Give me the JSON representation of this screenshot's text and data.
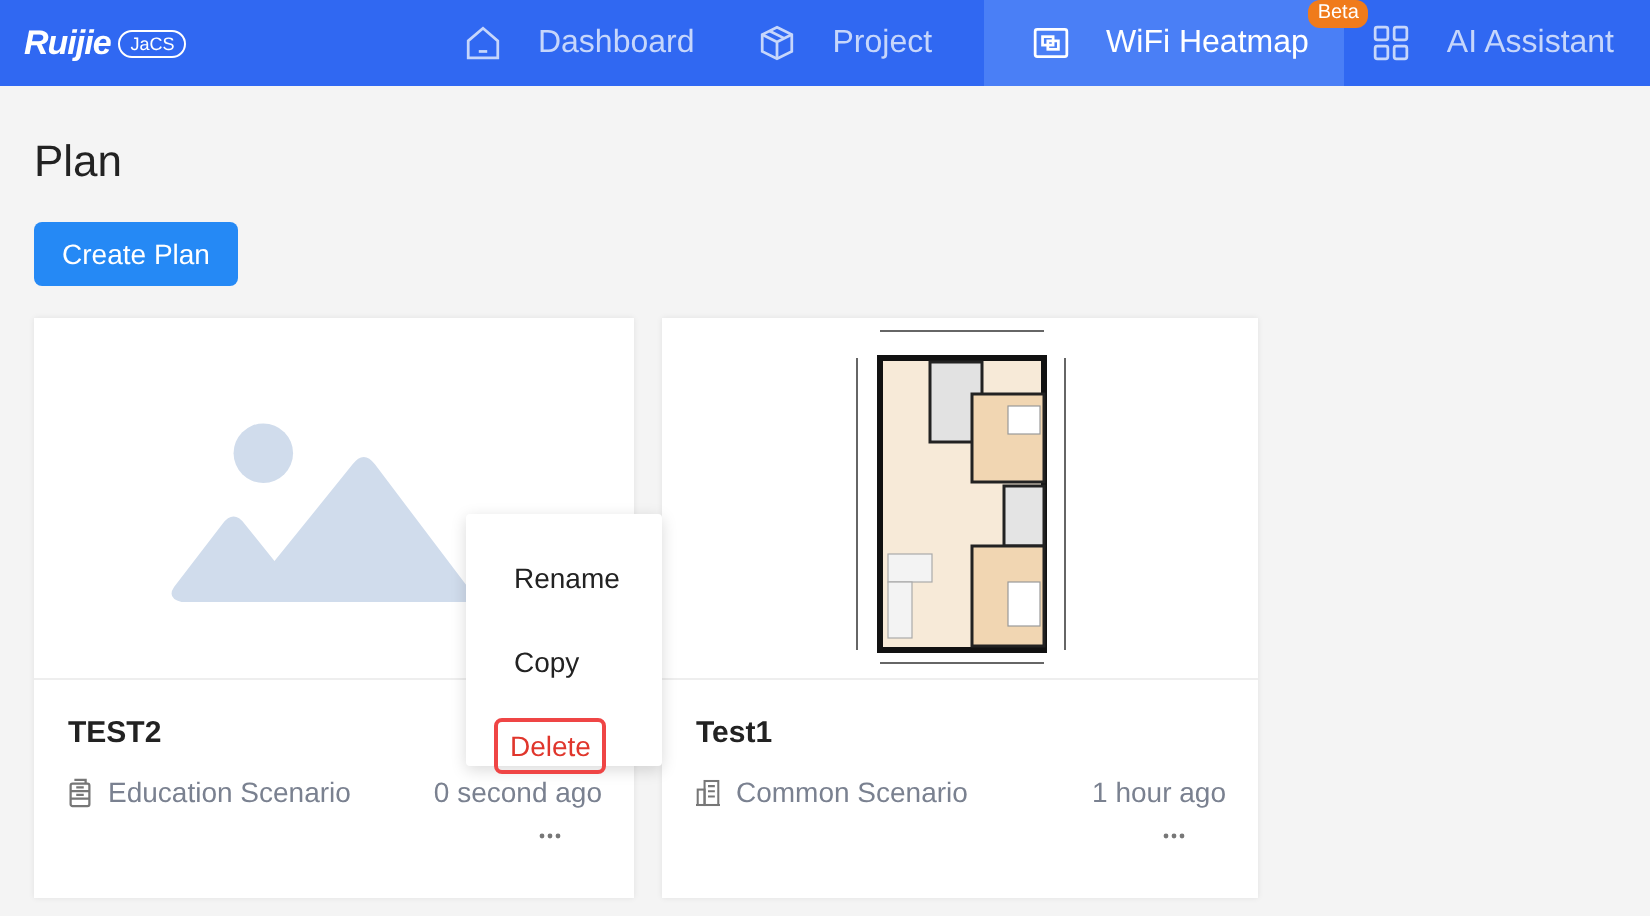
{
  "logo": {
    "brand": "Ruijie",
    "badge": "JaCS"
  },
  "nav": [
    {
      "label": "Dashboard",
      "kind": "home",
      "selected": false
    },
    {
      "label": "Project",
      "kind": "cube",
      "selected": false
    },
    {
      "label": "WiFi Heatmap",
      "kind": "heatmap",
      "selected": true,
      "badge": "Beta"
    },
    {
      "label": "AI Assistant",
      "kind": "grid",
      "selected": false
    }
  ],
  "page_title": "Plan",
  "create_button": "Create Plan",
  "plans": [
    {
      "title": "TEST2",
      "scenario": {
        "label": "Education Scenario",
        "kind": "education"
      },
      "time": "0 second ago",
      "thumbnail": {
        "kind": "placeholder"
      },
      "menu_open": true
    },
    {
      "title": "Test1",
      "scenario": {
        "label": "Common Scenario",
        "kind": "common"
      },
      "time": "1 hour ago",
      "menu_open": false
    }
  ],
  "menu": [
    {
      "label": "Rename",
      "kind": "normal",
      "selected": false
    },
    {
      "label": "Copy",
      "kind": "normal",
      "selected": false
    },
    {
      "label": "Delete",
      "kind": "danger",
      "selected": true
    }
  ]
}
